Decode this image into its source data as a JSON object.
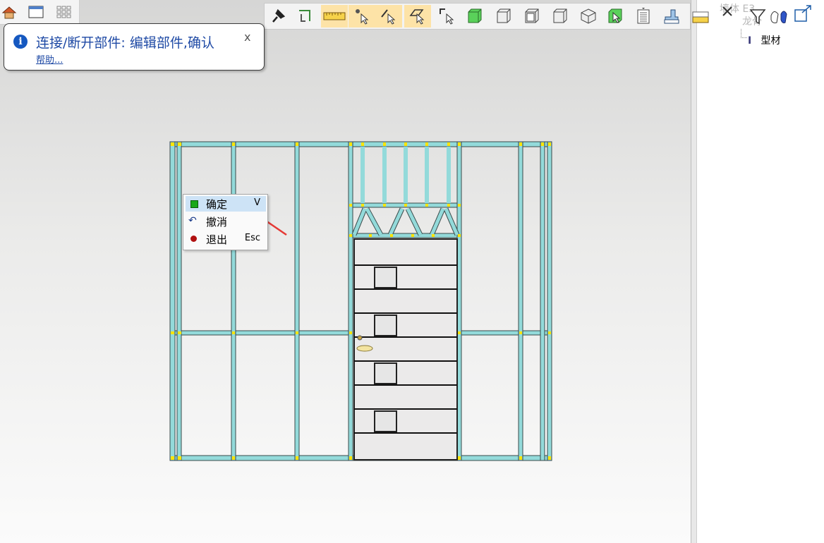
{
  "viewport": {
    "tooltip": {
      "title": "连接/断开部件: 编辑部件,确认",
      "help_link": "帮助...",
      "close_label": "x"
    },
    "context_menu": {
      "items": [
        {
          "label": "确定",
          "shortcut": "V",
          "icon": "green-square-icon"
        },
        {
          "label": "撤消",
          "shortcut": "",
          "icon": "undo-icon"
        },
        {
          "label": "退出",
          "shortcut": "Esc",
          "icon": "red-dot-icon"
        }
      ]
    }
  },
  "tree": {
    "nodes": [
      {
        "label": "墙体 E3",
        "state": "faded"
      },
      {
        "label": "龙骨",
        "state": "faded"
      },
      {
        "label": "型材",
        "state": "normal"
      }
    ]
  },
  "view_tabs": {
    "icons": [
      "home-icon",
      "window-icon",
      "grid-icon"
    ]
  },
  "toolbar": {
    "icons": [
      "pin-icon",
      "rotate-icon",
      "ruler-icon",
      "point-select-icon",
      "edge-select-icon",
      "face-select-icon",
      "corner-select-icon",
      "green-cube-icon",
      "cube-outline-icon",
      "cube-front-icon",
      "cube-side-icon",
      "cube-iso-icon",
      "select-box-icon",
      "list-icon",
      "layers-icon",
      "stack-icon",
      "close-icon",
      "filter-icon",
      "parts-icon",
      "export-icon"
    ]
  },
  "colors": {
    "frame": "#93dada",
    "frame_edge": "#3a4a4a",
    "joint": "#ffe500",
    "accent": "#1f4aa5",
    "toolbar_selected": "#fde3a7",
    "menu_highlight": "#cde3f6",
    "arrow": "#e53935"
  }
}
